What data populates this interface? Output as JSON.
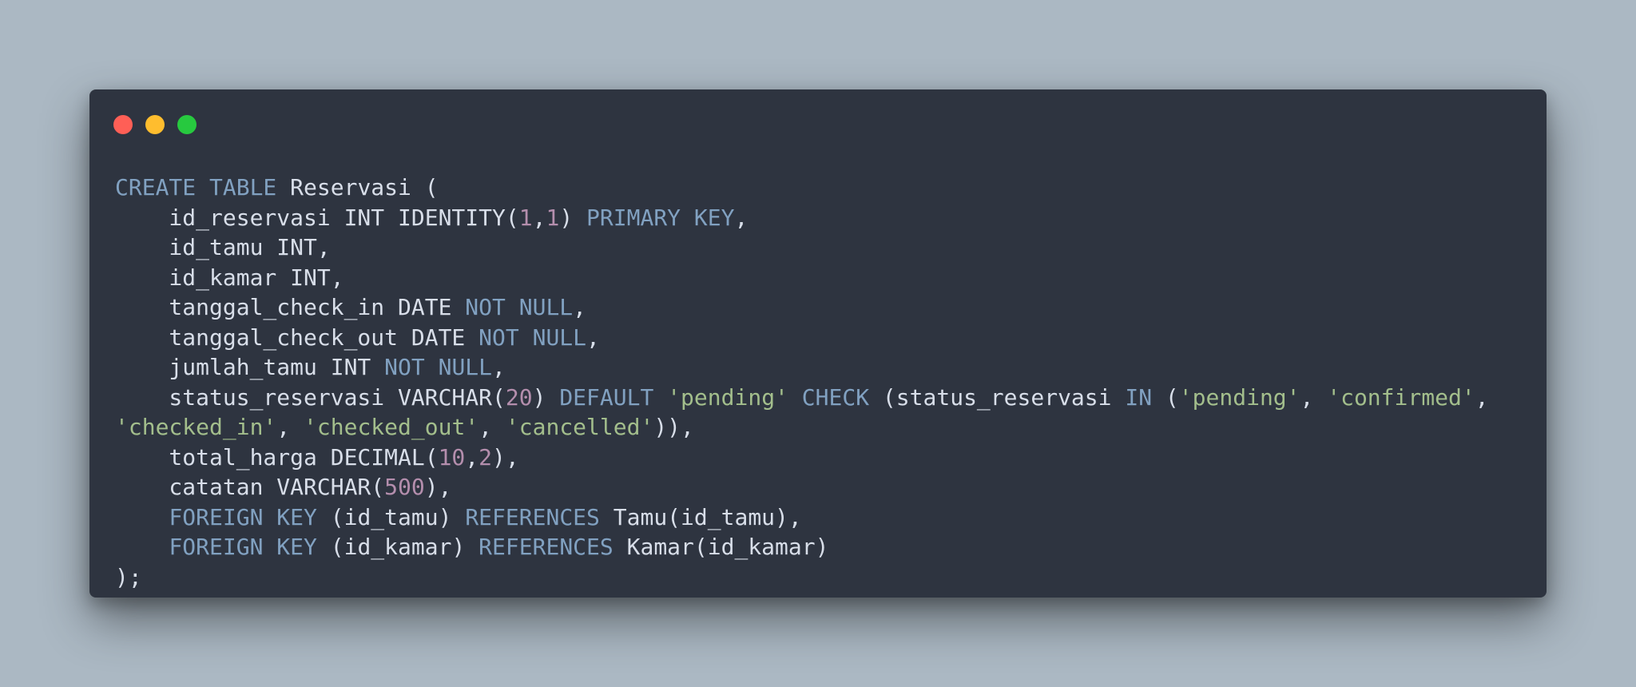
{
  "window": {
    "controls": [
      {
        "name": "close",
        "color": "#ff5f56"
      },
      {
        "name": "minimize",
        "color": "#ffbd2e"
      },
      {
        "name": "maximize",
        "color": "#27c93f"
      }
    ]
  },
  "theme": {
    "background": "#abb8c3",
    "window_bg": "#2e3440",
    "keyword": "#81a1c1",
    "identifier": "#d8dee9",
    "number": "#b48ead",
    "string": "#a3be8c"
  },
  "code": {
    "language": "sql",
    "lines": [
      [
        {
          "t": "kw",
          "v": "CREATE TABLE"
        },
        {
          "t": "id",
          "v": " Reservasi ("
        }
      ],
      [
        {
          "t": "id",
          "v": "    id_reservasi INT IDENTITY("
        },
        {
          "t": "num",
          "v": "1"
        },
        {
          "t": "pn",
          "v": ","
        },
        {
          "t": "num",
          "v": "1"
        },
        {
          "t": "pn",
          "v": ") "
        },
        {
          "t": "kw",
          "v": "PRIMARY KEY"
        },
        {
          "t": "pn",
          "v": ","
        }
      ],
      [
        {
          "t": "id",
          "v": "    id_tamu INT,"
        }
      ],
      [
        {
          "t": "id",
          "v": "    id_kamar INT,"
        }
      ],
      [
        {
          "t": "id",
          "v": "    tanggal_check_in DATE "
        },
        {
          "t": "kw",
          "v": "NOT NULL"
        },
        {
          "t": "pn",
          "v": ","
        }
      ],
      [
        {
          "t": "id",
          "v": "    tanggal_check_out DATE "
        },
        {
          "t": "kw",
          "v": "NOT NULL"
        },
        {
          "t": "pn",
          "v": ","
        }
      ],
      [
        {
          "t": "id",
          "v": "    jumlah_tamu INT "
        },
        {
          "t": "kw",
          "v": "NOT NULL"
        },
        {
          "t": "pn",
          "v": ","
        }
      ],
      [
        {
          "t": "id",
          "v": "    status_reservasi VARCHAR("
        },
        {
          "t": "num",
          "v": "20"
        },
        {
          "t": "pn",
          "v": ") "
        },
        {
          "t": "kw",
          "v": "DEFAULT"
        },
        {
          "t": "pn",
          "v": " "
        },
        {
          "t": "str",
          "v": "'pending'"
        },
        {
          "t": "pn",
          "v": " "
        },
        {
          "t": "kw",
          "v": "CHECK"
        },
        {
          "t": "pn",
          "v": " (status_reservasi "
        },
        {
          "t": "kw",
          "v": "IN"
        },
        {
          "t": "pn",
          "v": " ("
        },
        {
          "t": "str",
          "v": "'pending'"
        },
        {
          "t": "pn",
          "v": ", "
        },
        {
          "t": "str",
          "v": "'confirmed'"
        },
        {
          "t": "pn",
          "v": ","
        }
      ],
      [
        {
          "t": "str",
          "v": "'checked_in'"
        },
        {
          "t": "pn",
          "v": ", "
        },
        {
          "t": "str",
          "v": "'checked_out'"
        },
        {
          "t": "pn",
          "v": ", "
        },
        {
          "t": "str",
          "v": "'cancelled'"
        },
        {
          "t": "pn",
          "v": ")),"
        }
      ],
      [
        {
          "t": "id",
          "v": "    total_harga DECIMAL("
        },
        {
          "t": "num",
          "v": "10"
        },
        {
          "t": "pn",
          "v": ","
        },
        {
          "t": "num",
          "v": "2"
        },
        {
          "t": "pn",
          "v": "),"
        }
      ],
      [
        {
          "t": "id",
          "v": "    catatan VARCHAR("
        },
        {
          "t": "num",
          "v": "500"
        },
        {
          "t": "pn",
          "v": "),"
        }
      ],
      [
        {
          "t": "id",
          "v": "    "
        },
        {
          "t": "kw",
          "v": "FOREIGN KEY"
        },
        {
          "t": "pn",
          "v": " (id_tamu) "
        },
        {
          "t": "kw",
          "v": "REFERENCES"
        },
        {
          "t": "id",
          "v": " Tamu(id_tamu),"
        }
      ],
      [
        {
          "t": "id",
          "v": "    "
        },
        {
          "t": "kw",
          "v": "FOREIGN KEY"
        },
        {
          "t": "pn",
          "v": " (id_kamar) "
        },
        {
          "t": "kw",
          "v": "REFERENCES"
        },
        {
          "t": "id",
          "v": " Kamar(id_kamar)"
        }
      ],
      [
        {
          "t": "pn",
          "v": ");"
        }
      ]
    ]
  }
}
